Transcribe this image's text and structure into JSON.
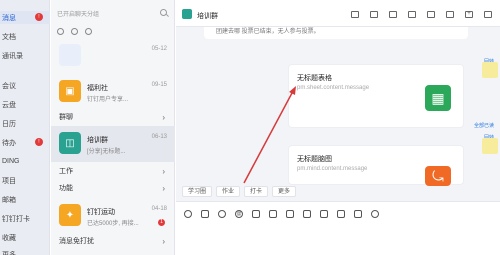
{
  "nav": {
    "items": [
      {
        "label": "消息",
        "badge": "!",
        "active": true
      },
      {
        "label": "文档"
      },
      {
        "label": "通讯录"
      },
      {
        "label": "会议"
      },
      {
        "label": "云盘"
      },
      {
        "label": "日历"
      },
      {
        "label": "待办",
        "badge": "!"
      },
      {
        "label": "DING"
      },
      {
        "label": "项目"
      },
      {
        "label": "邮箱"
      },
      {
        "label": "钉钉打卡"
      },
      {
        "label": "收藏"
      },
      {
        "label": "更多"
      }
    ]
  },
  "list": {
    "search_placeholder": "已开启聊天分组",
    "conversations": [
      {
        "title": "",
        "subtitle": "",
        "time": "05-12",
        "color": "#e9eefb"
      },
      {
        "title": "福利社",
        "subtitle": "钉钉用户专享...",
        "time": "09-15",
        "color": "#f5a623",
        "icon": "gift-icon"
      },
      {
        "title": "培训群",
        "subtitle": "[分享]无标题...",
        "time": "06-13",
        "color": "#2aa292",
        "icon": "group-chat-icon",
        "selected": true
      },
      {
        "title": "钉钉运动",
        "subtitle": "已达5000步, 再接...",
        "time": "04-18",
        "color": "#f5a623",
        "icon": "runner-icon",
        "badge": "1"
      }
    ],
    "sections": [
      {
        "label": "群聊"
      },
      {
        "label": "工作"
      },
      {
        "label": "功能"
      },
      {
        "label": "消息免打扰"
      }
    ]
  },
  "chat": {
    "group_name": "培训群",
    "notice_text": "团建去哪  投票已结束，无人参与投票。",
    "reply_label": "回转",
    "read_label": "全部已读",
    "cards": [
      {
        "title": "无标题表格",
        "url": "pm.sheet.content.message",
        "color": "#2ca85a",
        "icon": "sheet-grid-icon"
      },
      {
        "title": "无标题脑图",
        "url": "pm.mind.content.message",
        "color": "#f06a26",
        "icon": "mindmap-icon"
      }
    ],
    "shortcuts": [
      "学习圈",
      "作业",
      "打卡",
      "更多"
    ],
    "toolbar_icons": [
      "emoji-icon",
      "thumbs-up-icon",
      "scissors-icon",
      "at-icon",
      "image-icon",
      "lightning-icon",
      "file-icon",
      "calendar-icon",
      "checkbox-icon",
      "folder-icon",
      "task-icon",
      "phone-icon"
    ],
    "header_icons": [
      "image-icon",
      "edit-icon",
      "calendar-icon",
      "folder-icon",
      "monitor-icon",
      "phone-icon",
      "add-icon",
      "settings-icon"
    ]
  }
}
